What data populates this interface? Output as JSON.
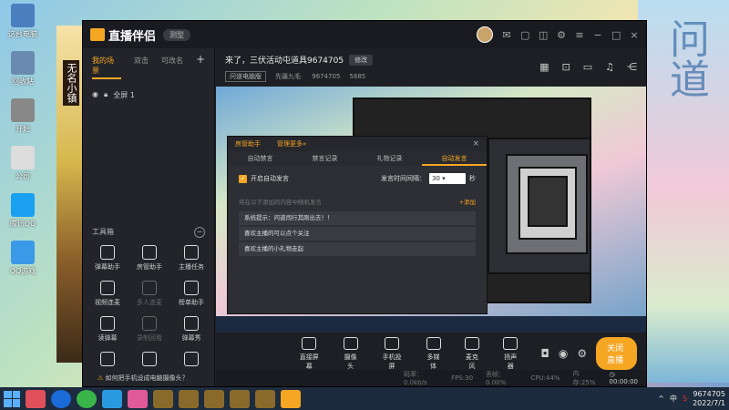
{
  "desktop": {
    "icons": [
      {
        "label": "这台电脑",
        "color": "#4a7fc0"
      },
      {
        "label": "回收站",
        "color": "#6a8ab0"
      },
      {
        "label": "开始",
        "color": "#888"
      },
      {
        "label": "公司",
        "color": "#ddd"
      },
      {
        "label": "腾讯QQ",
        "color": "#1aa0f0"
      },
      {
        "label": "QQ游戏",
        "color": "#3a9ae8"
      }
    ],
    "left_banner_text": "无名小镇",
    "right_banner_text": "问道"
  },
  "app": {
    "logo": "直播伴侣",
    "version": "测型"
  },
  "sidebar": {
    "tabs": [
      "我的场景",
      "双击",
      "可改名"
    ],
    "add": "+",
    "scene": "全屏 1",
    "tools_header": "工具箱",
    "tools_collapse": "−",
    "tools": [
      {
        "name": "tool-danmu",
        "label": "弹幕助手",
        "dim": false
      },
      {
        "name": "tool-fangguan",
        "label": "房管助手",
        "dim": false
      },
      {
        "name": "tool-task",
        "label": "主播任务",
        "dim": false
      },
      {
        "name": "tool-video",
        "label": "视频连麦",
        "dim": false
      },
      {
        "name": "tool-multi",
        "label": "多人连麦",
        "dim": true
      },
      {
        "name": "tool-rank",
        "label": "榜单助手",
        "dim": false
      },
      {
        "name": "tool-read",
        "label": "读弹幕",
        "dim": false
      },
      {
        "name": "tool-record",
        "label": "录制回看",
        "dim": true
      },
      {
        "name": "tool-show",
        "label": "弹幕秀",
        "dim": false
      },
      {
        "name": "tool-more1",
        "label": "",
        "dim": false
      },
      {
        "name": "tool-more2",
        "label": "",
        "dim": false
      },
      {
        "name": "tool-more3",
        "label": "",
        "dim": false
      }
    ]
  },
  "room": {
    "title": "来了，三伏活动屯道具9674705",
    "edit": "修改",
    "category": "问道电脑版",
    "host": "先疆九毛·",
    "room_id": "9674705",
    "fans": "5885"
  },
  "dialog": {
    "header_tabs": [
      "房管助手",
      "管理更多»"
    ],
    "tabs": [
      "自动禁言",
      "禁言记录",
      "礼物记录",
      "自动发言"
    ],
    "active_tab": 3,
    "enable_label": "开启自动发言",
    "interval_label": "发言时间间隔：",
    "interval_value": "30",
    "interval_unit": "秒",
    "hint": "将在以下添加的内容中随机发言",
    "add": "+添加",
    "messages": [
      "系统提示：问道闯行其刚出去！！",
      "喜欢主播的可以点个关注",
      "喜欢主播的小礼物走起"
    ]
  },
  "toolbar": {
    "buttons": [
      "直接屏幕",
      "摄像头",
      "手机投屏",
      "多媒体",
      "麦克风",
      "扬声器"
    ],
    "live_button": "关闭直播"
  },
  "status": {
    "tip": "如何把手机设成电脑摄像头？",
    "bitrate": "码率：0.0kb/s",
    "fps": "FPS:30",
    "drop": "丢帧：0.00%",
    "cpu": "CPU:44%",
    "mem": "内存:25%",
    "time": "00:00:00"
  },
  "taskbar": {
    "room_id": "9674705",
    "date": "2022/7/1",
    "lang": "中"
  }
}
